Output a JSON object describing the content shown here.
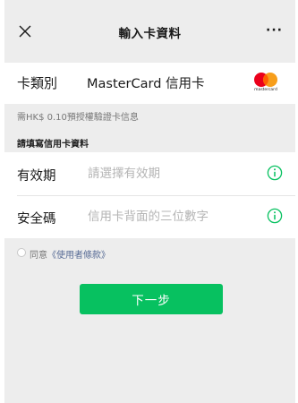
{
  "header": {
    "title": "輸入卡資料",
    "more": "···"
  },
  "card_type": {
    "label": "卡類別",
    "value": "MasterCard 信用卡",
    "logo_text": "mastercard"
  },
  "fee_note": "需HK$ 0.10預授權驗證卡信息",
  "section_title": "請填寫信用卡資料",
  "form": {
    "expiry": {
      "label": "有效期",
      "placeholder": "請選擇有效期",
      "value": ""
    },
    "cvv": {
      "label": "安全碼",
      "placeholder": "信用卡背面的三位數字",
      "value": ""
    }
  },
  "agreement": {
    "prefix": "同意",
    "link": "《使用者條款》"
  },
  "next_button": "下一步",
  "colors": {
    "accent_green": "#07c160",
    "link_blue": "#576b95",
    "mastercard_red": "#eb001b",
    "mastercard_orange": "#f79e1b"
  }
}
